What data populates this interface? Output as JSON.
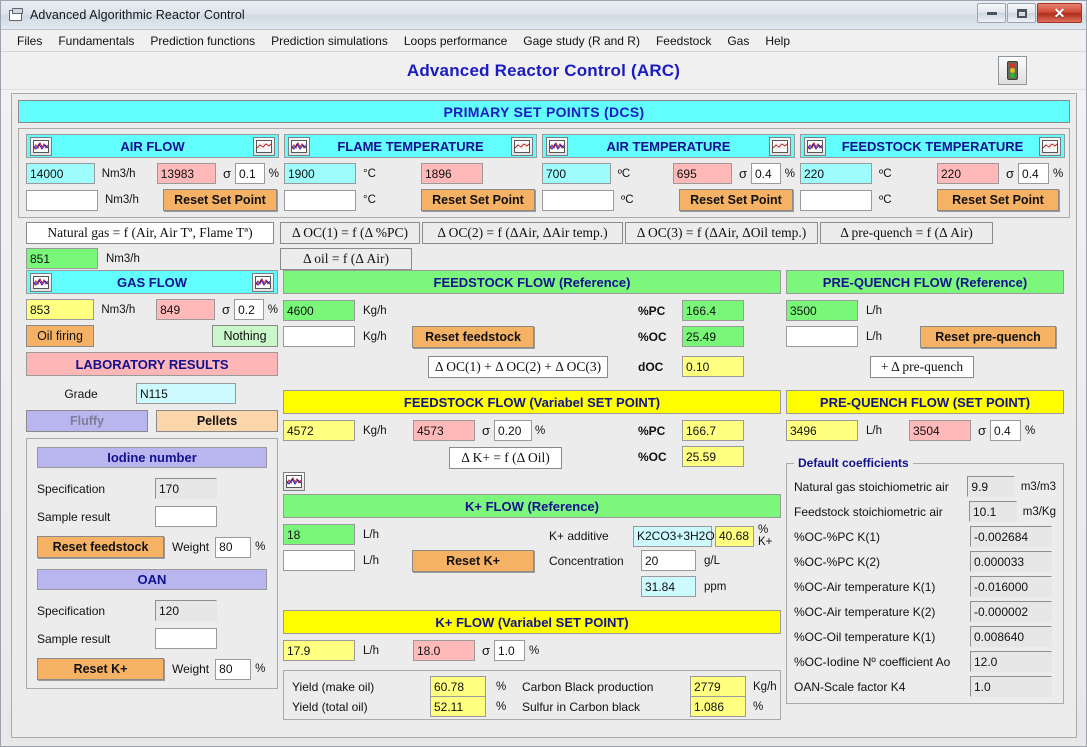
{
  "window": {
    "title": "Advanced Algorithmic Reactor Control",
    "icon": "window-icon",
    "minimize": "–",
    "maximize": "□",
    "close": "✕"
  },
  "menu": {
    "items": [
      "Files",
      "Fundamentals",
      "Prediction functions",
      "Prediction simulations",
      "Loops performance",
      "Gage study (R and R)",
      "Feedstock",
      "Gas",
      "Help"
    ]
  },
  "header": {
    "title": "Advanced Reactor Control (ARC)",
    "traffic_light_button": "traffic-light"
  },
  "banner": "PRIMARY SET POINTS (DCS)",
  "primary_setpoints": [
    {
      "title": "AIR FLOW",
      "setpoint": "14000",
      "unit": "Nm3/h",
      "actual": "13983",
      "sigma_label": "σ",
      "sigma": "0.1",
      "percent": "%",
      "new_value": "",
      "unit2": "Nm3/h",
      "reset_label": "Reset Set Point"
    },
    {
      "title": "FLAME TEMPERATURE",
      "setpoint": "1900",
      "unit": "°C",
      "actual": "1896",
      "sigma_label": "",
      "sigma": "",
      "percent": "",
      "new_value": "",
      "unit2": "°C",
      "reset_label": "Reset Set Point"
    },
    {
      "title": "AIR TEMPERATURE",
      "setpoint": "700",
      "unit": "ºC",
      "actual": "695",
      "sigma_label": "σ",
      "sigma": "0.4",
      "percent": "%",
      "new_value": "",
      "unit2": "ºC",
      "reset_label": "Reset Set Point"
    },
    {
      "title": "FEEDSTOCK TEMPERATURE",
      "setpoint": "220",
      "unit": "ºC",
      "actual": "220",
      "sigma_label": "σ",
      "sigma": "0.4",
      "percent": "%",
      "new_value": "",
      "unit2": "ºC",
      "reset_label": "Reset Set Point"
    }
  ],
  "formulas": {
    "natural_gas": "Natural gas = f (Air, Air Tª, Flame Tª)",
    "natural_gas_value": "851",
    "natural_gas_unit": "Nm3/h",
    "oc1": "Δ OC(1) = f (Δ %PC)",
    "oc2": "Δ OC(2) = f (ΔAir, ΔAir temp.)",
    "oc3": "Δ OC(3) = f (ΔAir, ΔOil temp.)",
    "prequench": "Δ pre-quench = f (Δ Air)",
    "oil": "Δ oil = f (Δ Air)",
    "oc_sum": "Δ OC(1) + Δ OC(2) + Δ OC(3)",
    "plus_prequench": "+ Δ pre-quench",
    "delta_k": "Δ K+ = f (Δ Oil)"
  },
  "gas_flow": {
    "title": "GAS FLOW",
    "setpoint": "853",
    "unit": "Nm3/h",
    "actual": "849",
    "sigma_label": "σ",
    "sigma": "0.2",
    "percent": "%",
    "oil_firing_label": "Oil firing",
    "nothing_label": "Nothing"
  },
  "laboratory": {
    "title": "LABORATORY RESULTS",
    "grade_label": "Grade",
    "grade_value": "N115",
    "fluffy_label": "Fluffy",
    "pellets_label": "Pellets",
    "iodine": {
      "title": "Iodine number",
      "spec_label": "Specification",
      "spec_value": "170",
      "sample_label": "Sample result",
      "sample_value": "",
      "reset_label": "Reset feedstock",
      "weight_label": "Weight",
      "weight_value": "80",
      "percent": "%"
    },
    "oan": {
      "title": "OAN",
      "spec_label": "Specification",
      "spec_value": "120",
      "sample_label": "Sample result",
      "sample_value": "",
      "reset_label": "Reset K+",
      "weight_label": "Weight",
      "weight_value": "80",
      "percent": "%"
    }
  },
  "feedstock_reference": {
    "title": "FEEDSTOCK FLOW (Reference)",
    "value": "4600",
    "unit": "Kg/h",
    "new_value": "",
    "unit2": "Kg/h",
    "reset_label": "Reset feedstock",
    "pc_label": "%PC",
    "pc_value": "166.4",
    "oc_label": "%OC",
    "oc_value": "25.49",
    "doc_label": "dOC",
    "doc_value": "0.10"
  },
  "prequench_reference": {
    "title": "PRE-QUENCH FLOW (Reference)",
    "value": "3500",
    "unit": "L/h",
    "new_value": "",
    "unit2": "L/h",
    "reset_label": "Reset pre-quench"
  },
  "feedstock_setpoint": {
    "title": "FEEDSTOCK FLOW (Variabel SET POINT)",
    "value": "4572",
    "unit": "Kg/h",
    "actual": "4573",
    "sigma_label": "σ",
    "sigma": "0.20",
    "percent": "%",
    "pc_label": "%PC",
    "pc_value": "166.7",
    "oc_label": "%OC",
    "oc_value": "25.59"
  },
  "prequench_setpoint": {
    "title": "PRE-QUENCH FLOW (SET POINT)",
    "value": "3496",
    "unit": "L/h",
    "actual": "3504",
    "sigma_label": "σ",
    "sigma": "0.4",
    "percent": "%"
  },
  "k_reference": {
    "title": "K+ FLOW (Reference)",
    "value": "18",
    "unit": "L/h",
    "new_value": "",
    "unit2": "L/h",
    "reset_label": "Reset K+",
    "additive_label": "K+ additive",
    "additive_value": "K2CO3+3H2O",
    "additive_pct": "40.68",
    "additive_pct_unit": "% K+",
    "concentration_label": "Concentration",
    "concentration_value": "20",
    "concentration_unit": "g/L",
    "ppm_value": "31.84",
    "ppm_unit": "ppm"
  },
  "k_setpoint": {
    "title": "K+ FLOW (Variabel SET POINT)",
    "value": "17.9",
    "unit": "L/h",
    "actual": "18.0",
    "sigma_label": "σ",
    "sigma": "1.0",
    "percent": "%"
  },
  "yields": {
    "rows": [
      {
        "label": "Yield (make oil)",
        "value": "60.78",
        "unit": "%"
      },
      {
        "label": "Yield (total oil)",
        "value": "52.11",
        "unit": "%"
      }
    ],
    "right_rows": [
      {
        "label": "Carbon Black production",
        "value": "2779",
        "unit": "Kg/h"
      },
      {
        "label": "Sulfur in Carbon black",
        "value": "1.086",
        "unit": "%"
      }
    ]
  },
  "default_coefficients": {
    "legend": "Default coefficients",
    "rows": [
      {
        "label": "Natural gas stoichiometric air",
        "value": "9.9",
        "unit": "m3/m3"
      },
      {
        "label": "Feedstock stoichiometric air",
        "value": "10.1",
        "unit": "m3/Kg"
      },
      {
        "label": "%OC-%PC K(1)",
        "value": "-0.002684",
        "unit": ""
      },
      {
        "label": "%OC-%PC K(2)",
        "value": "0.000033",
        "unit": ""
      },
      {
        "label": "%OC-Air temperature K(1)",
        "value": "-0.016000",
        "unit": ""
      },
      {
        "label": "%OC-Air temperature K(2)",
        "value": "-0.000002",
        "unit": ""
      },
      {
        "label": "%OC-Oil temperature K(1)",
        "value": "0.008640",
        "unit": ""
      },
      {
        "label": "%OC-Iodine Nº  coefficient Ao",
        "value": "12.0",
        "unit": ""
      },
      {
        "label": "OAN-Scale factor K4",
        "value": "1.0",
        "unit": ""
      }
    ]
  },
  "colors": {
    "accent_blue": "#11118f",
    "cyan": "#62fdfd",
    "green": "#7cf77c",
    "yellow": "#ffff00",
    "pink": "#ffb6b6",
    "orange": "#f5b265",
    "purple": "#b9b6ef"
  }
}
